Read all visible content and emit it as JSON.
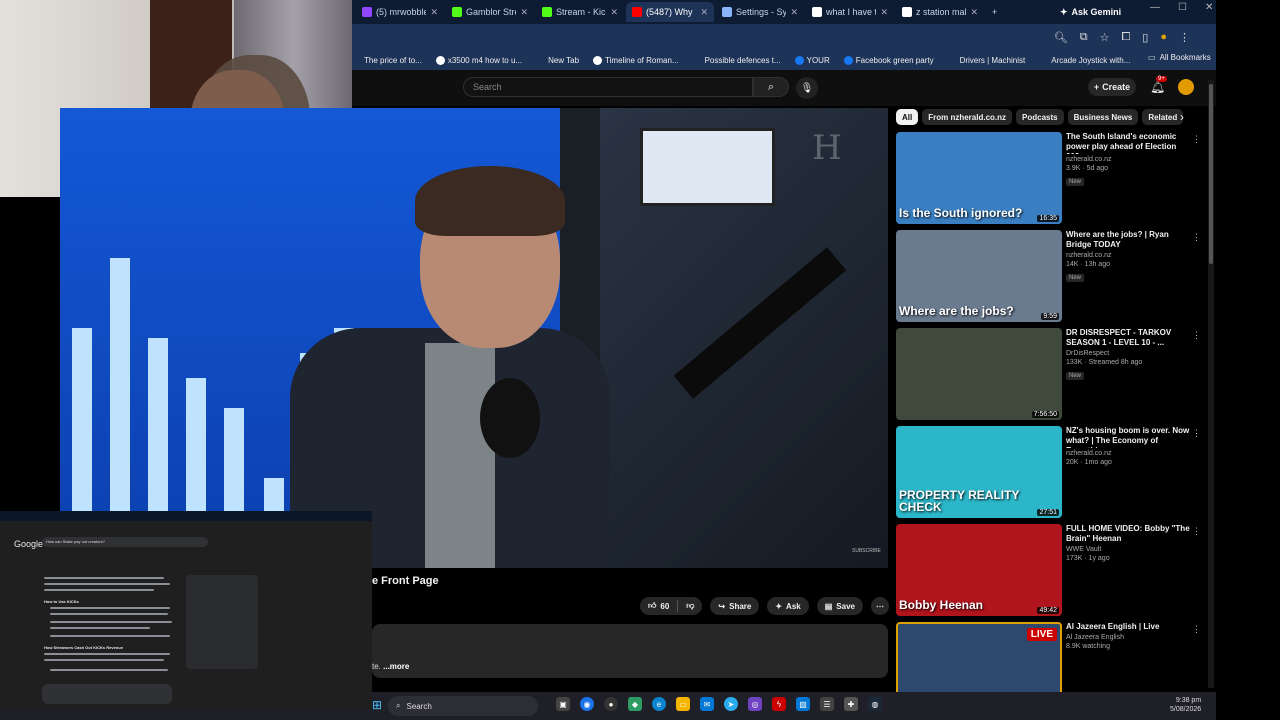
{
  "browser": {
    "tabs": [
      {
        "title": "(5) mrwobble",
        "icon": "twitch-icon",
        "color": "#9147ff",
        "active": false
      },
      {
        "title": "Gamblor Stream",
        "icon": "kick-icon",
        "color": "#53fc18",
        "active": false
      },
      {
        "title": "Stream - Kick",
        "icon": "kick-icon",
        "color": "#53fc18",
        "active": false
      },
      {
        "title": "(5487) Why",
        "icon": "youtube-icon",
        "color": "#ff0000",
        "active": true
      },
      {
        "title": "Settings - Syste",
        "icon": "gear-icon",
        "color": "#8ab4f8",
        "active": false
      },
      {
        "title": "what I have the",
        "icon": "google-icon",
        "color": "#ffffff",
        "active": false
      },
      {
        "title": "z station make",
        "icon": "google-icon",
        "color": "#ffffff",
        "active": false
      }
    ],
    "new_tab_symbol": "+",
    "ask_gemini": "Ask Gemini",
    "bookmarks": [
      {
        "label": "The price of to...",
        "color": "#1e3358"
      },
      {
        "label": "x3500 m4 how to u...",
        "color": "#ffffff"
      },
      {
        "label": "New Tab",
        "color": "#1e3358"
      },
      {
        "label": "Timeline of Roman...",
        "color": "#ffffff"
      },
      {
        "label": "Possible defences t...",
        "color": "#1e3358"
      },
      {
        "label": "YOUR",
        "color": "#1877f2"
      },
      {
        "label": "Facebook green party",
        "color": "#1877f2"
      },
      {
        "label": "Drivers | Machinist",
        "color": "#1e3358"
      },
      {
        "label": "Arcade Joystick with...",
        "color": "#1e3358"
      }
    ],
    "all_bookmarks": "All Bookmarks"
  },
  "youtube": {
    "search_placeholder": "Search",
    "create_label": "Create",
    "notification_count": "9+",
    "video_title_visible": "e Front Page",
    "likes": "60",
    "share_label": "Share",
    "ask_label": "Ask",
    "save_label": "Save",
    "desc_prefix": "te.",
    "desc_more": "...more",
    "player_watermark": "H",
    "player_credit": "SUBSCRIBE",
    "chips": [
      "All",
      "From nzherald.co.nz",
      "Podcasts",
      "Business News",
      "Related"
    ],
    "recommendations": [
      {
        "title": "The South Island's economic power play ahead of Election 202...",
        "channel": "nzherald.co.nz",
        "meta": "3.9K · 5d ago",
        "badge": "New",
        "duration": "16:35",
        "thumb_text": "Is the South ignored?",
        "thumb_color": "#3a7fc1",
        "live": false
      },
      {
        "title": "Where are the jobs? | Ryan Bridge TODAY",
        "channel": "nzherald.co.nz",
        "meta": "14K · 13h ago",
        "badge": "New",
        "duration": "9:59",
        "thumb_text": "Where are the jobs?",
        "thumb_color": "#6a7a8f",
        "live": false
      },
      {
        "title": "DR DISRESPECT - TARKOV SEASON 1 - LEVEL 10 - ...",
        "channel": "DrDisRespect",
        "meta": "133K · Streamed 8h ago",
        "badge": "New",
        "duration": "7:56:50",
        "thumb_text": "",
        "thumb_color": "#3f4a3c",
        "live": false
      },
      {
        "title": "NZ's housing boom is over. Now what? | The Economy of Everything",
        "channel": "nzherald.co.nz",
        "meta": "20K · 1mo ago",
        "badge": "",
        "duration": "27:51",
        "thumb_text": "PROPERTY REALITY CHECK",
        "thumb_color": "#2bb7c9",
        "live": false
      },
      {
        "title": "FULL HOME VIDEO: Bobby \"The Brain\" Heenan",
        "channel": "WWE Vault",
        "meta": "173K · 1y ago",
        "badge": "",
        "duration": "49:42",
        "thumb_text": "Bobby Heenan",
        "thumb_color": "#b0141c",
        "live": false
      },
      {
        "title": "Al Jazeera English | Live",
        "channel": "Al Jazeera English",
        "meta": "8.9K watching",
        "badge": "",
        "duration": "",
        "thumb_text": "",
        "thumb_color": "#2d4a6e",
        "live": true,
        "live_label": "LIVE"
      }
    ]
  },
  "overlay": {
    "google_logo": "Google",
    "search_text": "How can Stake pay out creators?",
    "heading1": "How to Use KICKs",
    "heading2": "How Streamers Cash Out KICKs Revenue"
  },
  "taskbar": {
    "search_label": "Search",
    "time": "9:38 pm",
    "date": "5/08/2026"
  }
}
